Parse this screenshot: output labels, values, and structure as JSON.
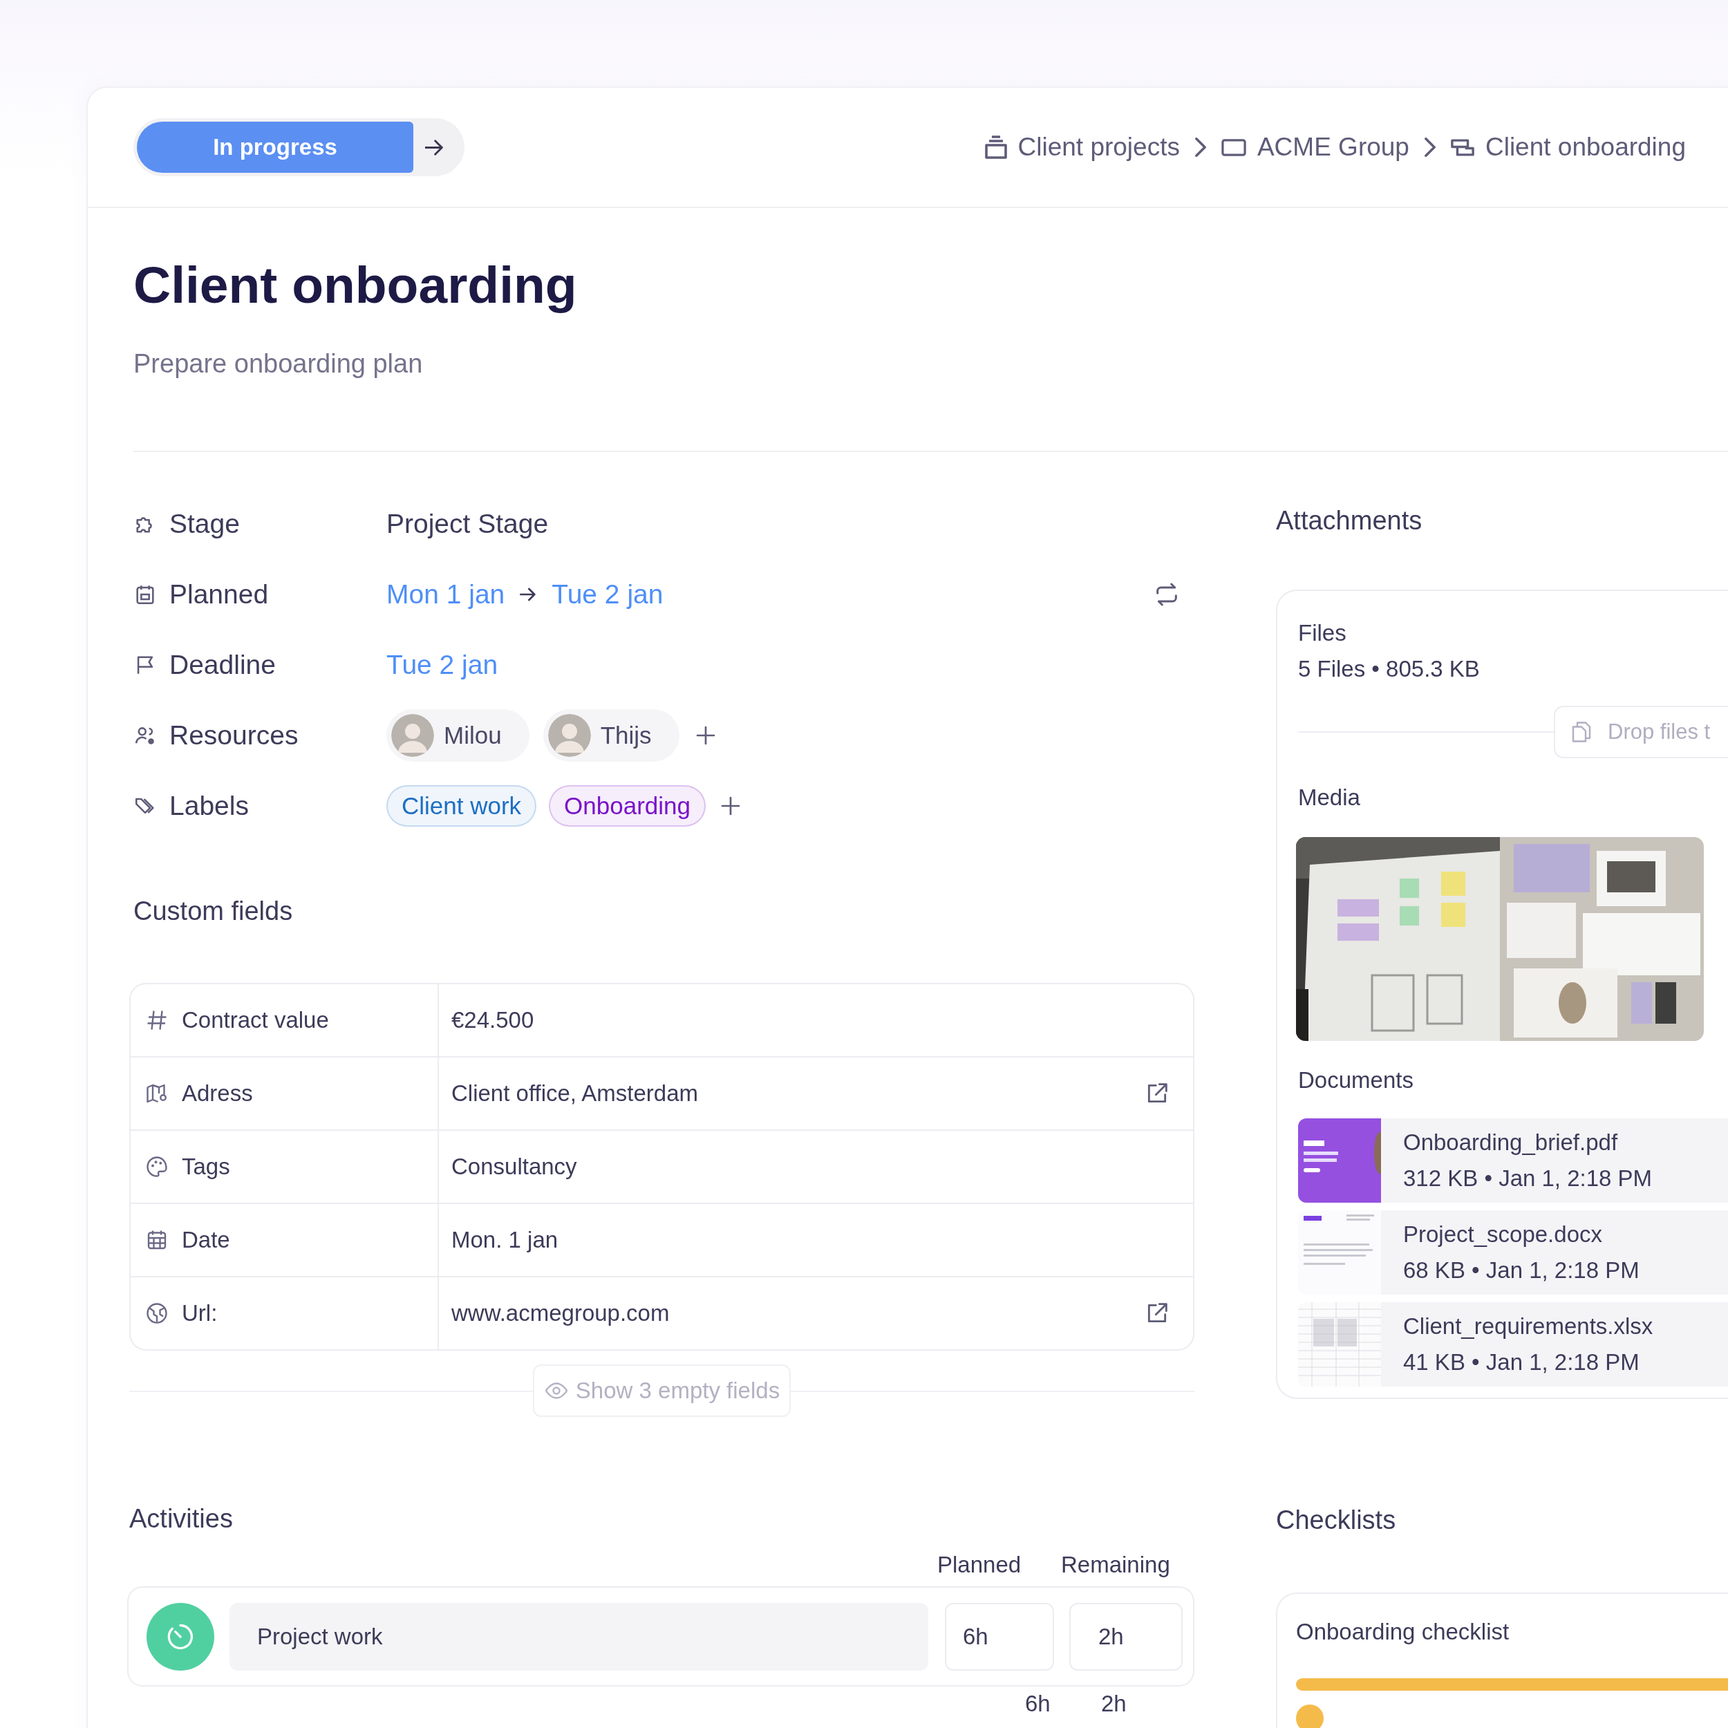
{
  "status_button": {
    "label": "In progress"
  },
  "breadcrumb": [
    {
      "label": "Client projects"
    },
    {
      "label": "ACME Group"
    },
    {
      "label": "Client onboarding"
    }
  ],
  "title": "Client onboarding",
  "subtitle": "Prepare onboarding plan",
  "properties": [
    {
      "label": "Stage",
      "kind": "text",
      "value": "Project Stage"
    },
    {
      "label": "Planned",
      "kind": "range",
      "start": "Mon 1 jan",
      "end": "Tue 2 jan"
    },
    {
      "label": "Deadline",
      "kind": "date",
      "value": "Tue 2 jan"
    },
    {
      "label": "Resources",
      "kind": "people",
      "people": [
        "Milou",
        "Thijs"
      ]
    },
    {
      "label": "Labels",
      "kind": "labels",
      "labels": [
        {
          "text": "Client work",
          "color": "#1d6fc2"
        },
        {
          "text": "Onboarding",
          "color": "#7a12c9"
        }
      ]
    }
  ],
  "custom_fields": {
    "heading": "Custom fields",
    "rows": [
      {
        "label": "Contract value",
        "value": "€24.500",
        "link": false
      },
      {
        "label": "Adress",
        "value": "Client office, Amsterdam",
        "link": true
      },
      {
        "label": "Tags",
        "value": "Consultancy",
        "link": false
      },
      {
        "label": "Date",
        "value": "Mon. 1 jan",
        "link": false
      },
      {
        "label": "Url:",
        "value": "www.acmegroup.com",
        "link": true
      }
    ],
    "show_empty": "Show 3 empty fields"
  },
  "activities": {
    "heading": "Activities",
    "columns": [
      "Planned",
      "Remaining"
    ],
    "rows": [
      {
        "name": "Project work",
        "planned": "6h",
        "remaining": "2h"
      }
    ],
    "totals": [
      "6h",
      "2h"
    ]
  },
  "attachments": {
    "heading": "Attachments",
    "files_title": "Files",
    "files_summary": "5 Files • 805.3 KB",
    "drop": "Drop files t",
    "media_heading": "Media",
    "documents_heading": "Documents",
    "documents": [
      {
        "name": "Onboarding_brief.pdf",
        "meta": "312 KB • Jan 1, 2:18 PM",
        "kind": "pdf"
      },
      {
        "name": "Project_scope.docx",
        "meta": "68 KB • Jan 1, 2:18 PM",
        "kind": "docx"
      },
      {
        "name": "Client_requirements.xlsx",
        "meta": "41 KB • Jan 1, 2:18 PM",
        "kind": "xlsx"
      }
    ]
  },
  "checklists": {
    "heading": "Checklists",
    "items": [
      {
        "title": "Onboarding checklist",
        "level": 1
      }
    ]
  }
}
